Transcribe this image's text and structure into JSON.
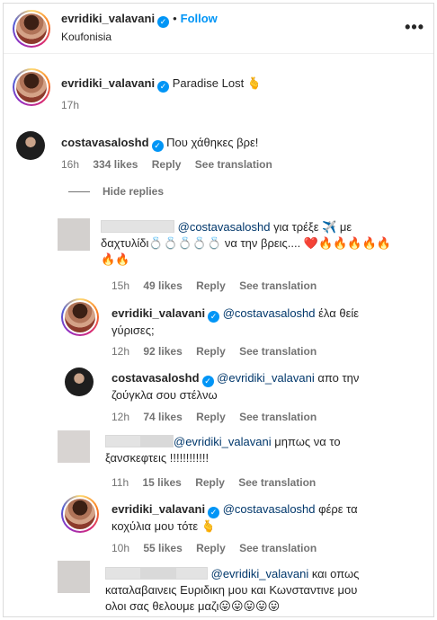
{
  "header": {
    "username": "evridiki_valavani",
    "follow_label": "Follow",
    "location": "Koufonisia",
    "more_label": "•••"
  },
  "caption": {
    "username": "evridiki_valavani",
    "text": "Paradise Lost",
    "emoji": "🫰",
    "time": "17h"
  },
  "comments": [
    {
      "username": "costavasaloshd",
      "text": "Που χάθηκες βρε!",
      "time": "16h",
      "likes": "334 likes",
      "reply": "Reply",
      "see_translation": "See translation"
    }
  ],
  "hide_replies_label": "Hide replies",
  "replies": [
    {
      "mention": "@costavasaloshd",
      "line1": "για τρέξε ✈️ με",
      "line2": "δαχτυλίδι💍💍💍💍💍 να την βρεις.... ❤️🔥🔥🔥🔥🔥",
      "line3": "🔥🔥",
      "time": "15h",
      "likes": "49 likes",
      "reply": "Reply",
      "see_translation": "See translation"
    },
    {
      "username": "evridiki_valavani",
      "mention": "@costavasaloshd",
      "line1": "έλα θείε",
      "line2": "γύρισες;",
      "time": "12h",
      "likes": "92 likes",
      "reply": "Reply",
      "see_translation": "See translation"
    },
    {
      "username": "costavasaloshd",
      "mention": "@evridiki_valavani",
      "line1": "απο την",
      "line2": "ζούγκλα σου στέλνω",
      "time": "12h",
      "likes": "74 likes",
      "reply": "Reply",
      "see_translation": "See translation"
    },
    {
      "mention": "@evridiki_valavani",
      "line1": "μηπως να το",
      "line2": "ξανσκεφτεις !!!!!!!!!!!!",
      "time": "11h",
      "likes": "15 likes",
      "reply": "Reply",
      "see_translation": "See translation"
    },
    {
      "username": "evridiki_valavani",
      "mention": "@costavasaloshd",
      "line1": "φέρε τα",
      "line2": "κοχύλια μου τότε",
      "emoji": "🫰",
      "time": "10h",
      "likes": "55 likes",
      "reply": "Reply",
      "see_translation": "See translation"
    },
    {
      "mention": "@evridiki_valavani",
      "line1": "και οπως",
      "line2": "καταλαβαινεις Ευριδικη μου και Κωνσταντινε μου",
      "line3": "ολοι σας θελουμε μαζι😛😛😛😛😛"
    }
  ],
  "icons": {
    "verified": "verified-badge-icon",
    "more": "more-options-icon"
  },
  "colors": {
    "link_blue": "#0095f6",
    "mention": "#00376b",
    "meta_gray": "#737373"
  }
}
